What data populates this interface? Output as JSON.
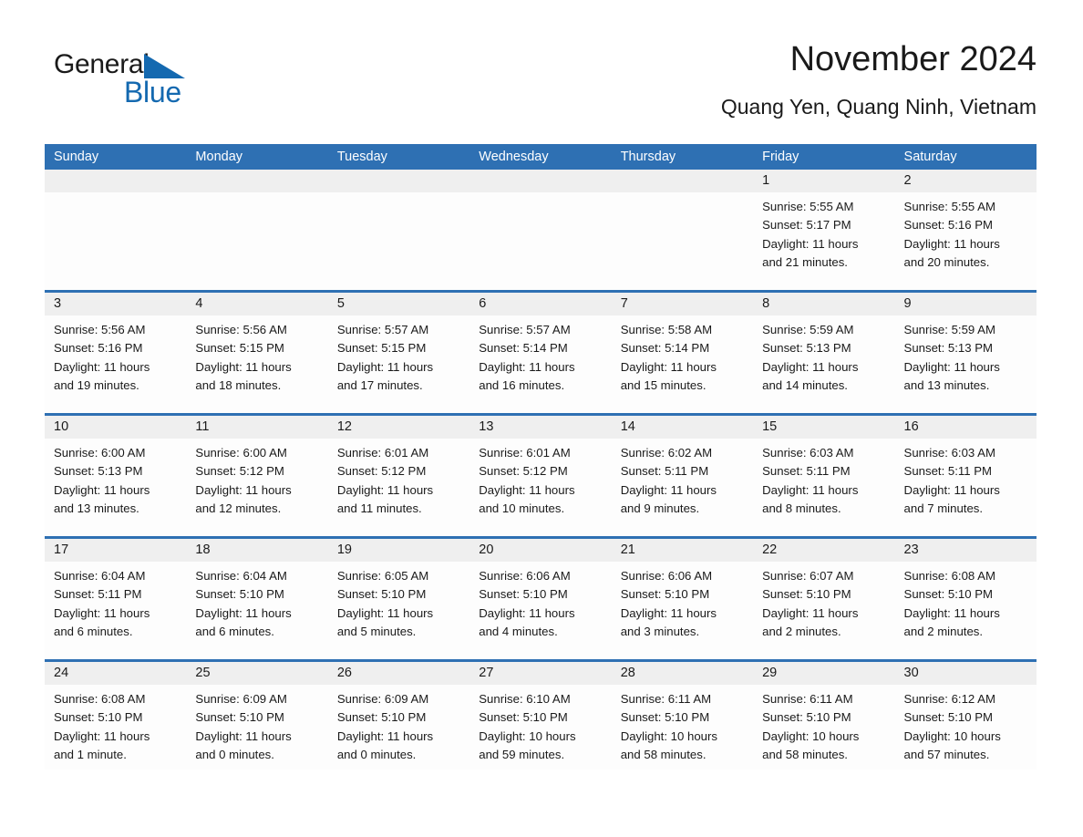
{
  "brand": {
    "name_part1": "General",
    "name_part2": "Blue",
    "triangle_icon": "triangle-icon",
    "accent_color": "#1469b0"
  },
  "header": {
    "title": "November 2024",
    "subtitle": "Quang Yen, Quang Ninh, Vietnam"
  },
  "colors": {
    "header_blue": "#2e70b3",
    "date_strip_gray": "#efefef",
    "cell_background": "#fdfdfd",
    "text": "#1a1a1a"
  },
  "weekdays": [
    "Sunday",
    "Monday",
    "Tuesday",
    "Wednesday",
    "Thursday",
    "Friday",
    "Saturday"
  ],
  "weeks": [
    [
      {
        "day": "",
        "sunrise": "",
        "sunset": "",
        "daylight1": "",
        "daylight2": ""
      },
      {
        "day": "",
        "sunrise": "",
        "sunset": "",
        "daylight1": "",
        "daylight2": ""
      },
      {
        "day": "",
        "sunrise": "",
        "sunset": "",
        "daylight1": "",
        "daylight2": ""
      },
      {
        "day": "",
        "sunrise": "",
        "sunset": "",
        "daylight1": "",
        "daylight2": ""
      },
      {
        "day": "",
        "sunrise": "",
        "sunset": "",
        "daylight1": "",
        "daylight2": ""
      },
      {
        "day": "1",
        "sunrise": "Sunrise: 5:55 AM",
        "sunset": "Sunset: 5:17 PM",
        "daylight1": "Daylight: 11 hours",
        "daylight2": "and 21 minutes."
      },
      {
        "day": "2",
        "sunrise": "Sunrise: 5:55 AM",
        "sunset": "Sunset: 5:16 PM",
        "daylight1": "Daylight: 11 hours",
        "daylight2": "and 20 minutes."
      }
    ],
    [
      {
        "day": "3",
        "sunrise": "Sunrise: 5:56 AM",
        "sunset": "Sunset: 5:16 PM",
        "daylight1": "Daylight: 11 hours",
        "daylight2": "and 19 minutes."
      },
      {
        "day": "4",
        "sunrise": "Sunrise: 5:56 AM",
        "sunset": "Sunset: 5:15 PM",
        "daylight1": "Daylight: 11 hours",
        "daylight2": "and 18 minutes."
      },
      {
        "day": "5",
        "sunrise": "Sunrise: 5:57 AM",
        "sunset": "Sunset: 5:15 PM",
        "daylight1": "Daylight: 11 hours",
        "daylight2": "and 17 minutes."
      },
      {
        "day": "6",
        "sunrise": "Sunrise: 5:57 AM",
        "sunset": "Sunset: 5:14 PM",
        "daylight1": "Daylight: 11 hours",
        "daylight2": "and 16 minutes."
      },
      {
        "day": "7",
        "sunrise": "Sunrise: 5:58 AM",
        "sunset": "Sunset: 5:14 PM",
        "daylight1": "Daylight: 11 hours",
        "daylight2": "and 15 minutes."
      },
      {
        "day": "8",
        "sunrise": "Sunrise: 5:59 AM",
        "sunset": "Sunset: 5:13 PM",
        "daylight1": "Daylight: 11 hours",
        "daylight2": "and 14 minutes."
      },
      {
        "day": "9",
        "sunrise": "Sunrise: 5:59 AM",
        "sunset": "Sunset: 5:13 PM",
        "daylight1": "Daylight: 11 hours",
        "daylight2": "and 13 minutes."
      }
    ],
    [
      {
        "day": "10",
        "sunrise": "Sunrise: 6:00 AM",
        "sunset": "Sunset: 5:13 PM",
        "daylight1": "Daylight: 11 hours",
        "daylight2": "and 13 minutes."
      },
      {
        "day": "11",
        "sunrise": "Sunrise: 6:00 AM",
        "sunset": "Sunset: 5:12 PM",
        "daylight1": "Daylight: 11 hours",
        "daylight2": "and 12 minutes."
      },
      {
        "day": "12",
        "sunrise": "Sunrise: 6:01 AM",
        "sunset": "Sunset: 5:12 PM",
        "daylight1": "Daylight: 11 hours",
        "daylight2": "and 11 minutes."
      },
      {
        "day": "13",
        "sunrise": "Sunrise: 6:01 AM",
        "sunset": "Sunset: 5:12 PM",
        "daylight1": "Daylight: 11 hours",
        "daylight2": "and 10 minutes."
      },
      {
        "day": "14",
        "sunrise": "Sunrise: 6:02 AM",
        "sunset": "Sunset: 5:11 PM",
        "daylight1": "Daylight: 11 hours",
        "daylight2": "and 9 minutes."
      },
      {
        "day": "15",
        "sunrise": "Sunrise: 6:03 AM",
        "sunset": "Sunset: 5:11 PM",
        "daylight1": "Daylight: 11 hours",
        "daylight2": "and 8 minutes."
      },
      {
        "day": "16",
        "sunrise": "Sunrise: 6:03 AM",
        "sunset": "Sunset: 5:11 PM",
        "daylight1": "Daylight: 11 hours",
        "daylight2": "and 7 minutes."
      }
    ],
    [
      {
        "day": "17",
        "sunrise": "Sunrise: 6:04 AM",
        "sunset": "Sunset: 5:11 PM",
        "daylight1": "Daylight: 11 hours",
        "daylight2": "and 6 minutes."
      },
      {
        "day": "18",
        "sunrise": "Sunrise: 6:04 AM",
        "sunset": "Sunset: 5:10 PM",
        "daylight1": "Daylight: 11 hours",
        "daylight2": "and 6 minutes."
      },
      {
        "day": "19",
        "sunrise": "Sunrise: 6:05 AM",
        "sunset": "Sunset: 5:10 PM",
        "daylight1": "Daylight: 11 hours",
        "daylight2": "and 5 minutes."
      },
      {
        "day": "20",
        "sunrise": "Sunrise: 6:06 AM",
        "sunset": "Sunset: 5:10 PM",
        "daylight1": "Daylight: 11 hours",
        "daylight2": "and 4 minutes."
      },
      {
        "day": "21",
        "sunrise": "Sunrise: 6:06 AM",
        "sunset": "Sunset: 5:10 PM",
        "daylight1": "Daylight: 11 hours",
        "daylight2": "and 3 minutes."
      },
      {
        "day": "22",
        "sunrise": "Sunrise: 6:07 AM",
        "sunset": "Sunset: 5:10 PM",
        "daylight1": "Daylight: 11 hours",
        "daylight2": "and 2 minutes."
      },
      {
        "day": "23",
        "sunrise": "Sunrise: 6:08 AM",
        "sunset": "Sunset: 5:10 PM",
        "daylight1": "Daylight: 11 hours",
        "daylight2": "and 2 minutes."
      }
    ],
    [
      {
        "day": "24",
        "sunrise": "Sunrise: 6:08 AM",
        "sunset": "Sunset: 5:10 PM",
        "daylight1": "Daylight: 11 hours",
        "daylight2": "and 1 minute."
      },
      {
        "day": "25",
        "sunrise": "Sunrise: 6:09 AM",
        "sunset": "Sunset: 5:10 PM",
        "daylight1": "Daylight: 11 hours",
        "daylight2": "and 0 minutes."
      },
      {
        "day": "26",
        "sunrise": "Sunrise: 6:09 AM",
        "sunset": "Sunset: 5:10 PM",
        "daylight1": "Daylight: 11 hours",
        "daylight2": "and 0 minutes."
      },
      {
        "day": "27",
        "sunrise": "Sunrise: 6:10 AM",
        "sunset": "Sunset: 5:10 PM",
        "daylight1": "Daylight: 10 hours",
        "daylight2": "and 59 minutes."
      },
      {
        "day": "28",
        "sunrise": "Sunrise: 6:11 AM",
        "sunset": "Sunset: 5:10 PM",
        "daylight1": "Daylight: 10 hours",
        "daylight2": "and 58 minutes."
      },
      {
        "day": "29",
        "sunrise": "Sunrise: 6:11 AM",
        "sunset": "Sunset: 5:10 PM",
        "daylight1": "Daylight: 10 hours",
        "daylight2": "and 58 minutes."
      },
      {
        "day": "30",
        "sunrise": "Sunrise: 6:12 AM",
        "sunset": "Sunset: 5:10 PM",
        "daylight1": "Daylight: 10 hours",
        "daylight2": "and 57 minutes."
      }
    ]
  ]
}
